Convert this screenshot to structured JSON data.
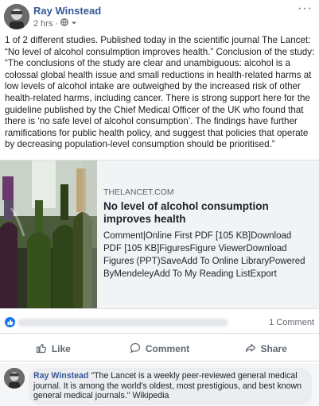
{
  "post": {
    "author": "Ray Winstead",
    "time": "2 hrs",
    "more_label": "···",
    "text": "1 of 2 different studies. Published today in the scientific journal The Lancet: “No level of alcohol consulmption improves health.” Conclusion of the study: “The conclusions of the study are clear and unambiguous: alcohol is a colossal global health issue and small reductions in health-related harms at low levels of alcohol intake are outweighed by the increased risk of other health-related harms, including cancer. There is strong support here for the guideline published by the Chief Medical Officer of the UK who found that there is ‘no safe level of alcohol consumption’. The findings have further ramifications for public health policy, and suggest that policies that operate by decreasing population-level consumption should be prioritised.”"
  },
  "link": {
    "domain": "THELANCET.COM",
    "title": "No level of alcohol consumption improves health",
    "description": "Comment|Online First PDF [105 KB]Download PDF [105 KB]FiguresFigure ViewerDownload Figures (PPT)SaveAdd To Online LibraryPowered ByMendeleyAdd To My Reading ListExport"
  },
  "stats": {
    "comments": "1 Comment"
  },
  "actions": {
    "like": "Like",
    "comment": "Comment",
    "share": "Share"
  },
  "comment": {
    "author": "Ray Winstead",
    "text": "\"The Lancet is a weekly peer-reviewed general medical journal. It is among the world's oldest, most prestigious, and best known general medical journals.\" Wikipedia"
  },
  "colors": {
    "link_blue": "#385898",
    "like_blue": "#1877f2"
  }
}
